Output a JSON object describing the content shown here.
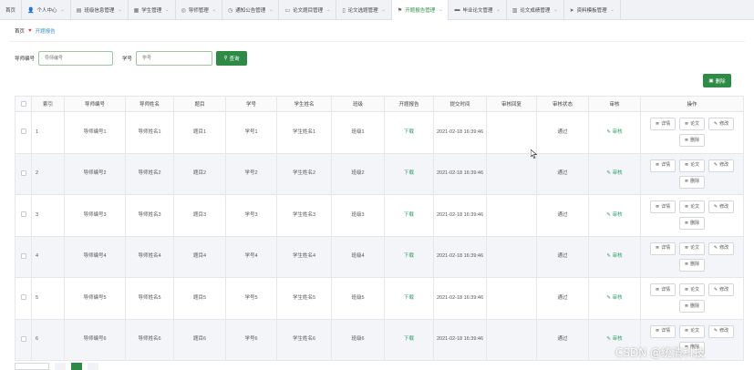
{
  "nav": [
    {
      "icon": "home-icon",
      "glyph": "",
      "label": "首页",
      "caret": false
    },
    {
      "icon": "user-icon",
      "glyph": "👤",
      "label": "个人中心",
      "caret": true
    },
    {
      "icon": "class-icon",
      "glyph": "▤",
      "label": "班级信息管理",
      "caret": true
    },
    {
      "icon": "student-icon",
      "glyph": "▦",
      "label": "学生管理",
      "caret": true
    },
    {
      "icon": "teacher-icon",
      "glyph": "◎",
      "label": "导师管理",
      "caret": true
    },
    {
      "icon": "notice-icon",
      "glyph": "◷",
      "label": "通知公告管理",
      "caret": true
    },
    {
      "icon": "topic-icon",
      "glyph": "▭",
      "label": "论文题目管理",
      "caret": true
    },
    {
      "icon": "select-icon",
      "glyph": "▯",
      "label": "论文选题管理",
      "caret": true
    },
    {
      "icon": "report-icon",
      "glyph": "⚑",
      "label": "开题报告管理",
      "caret": true
    },
    {
      "icon": "paper-icon",
      "glyph": "▬",
      "label": "毕业论文管理",
      "caret": true
    },
    {
      "icon": "grade-icon",
      "glyph": "▥",
      "label": "论文成绩管理",
      "caret": true
    },
    {
      "icon": "material-icon",
      "glyph": "➤",
      "label": "资料模板管理",
      "caret": true
    }
  ],
  "breadcrumb": {
    "home": "首页",
    "current": "开题报告"
  },
  "search": {
    "teacher_label": "导师编号",
    "teacher_placeholder": "导师编号",
    "student_label": "学号",
    "student_placeholder": "学号",
    "query_label": "查询"
  },
  "delete_label": "删除",
  "table": {
    "headers": [
      "索引",
      "导师编号",
      "导师姓名",
      "题目",
      "学号",
      "学生姓名",
      "班级",
      "开题报告",
      "提交时间",
      "审核回复",
      "审核状态",
      "审核",
      "操作"
    ],
    "rows": [
      {
        "idx": "1",
        "tno": "导师编号1",
        "tname": "导师姓名1",
        "title": "题目1",
        "sno": "学号1",
        "sname": "学生姓名1",
        "cls": "班级1",
        "report": "下载",
        "time": "2021-02-18 16:39:46",
        "reply": "",
        "status": "通过",
        "audit": "审核"
      },
      {
        "idx": "2",
        "tno": "导师编号2",
        "tname": "导师姓名2",
        "title": "题目2",
        "sno": "学号2",
        "sname": "学生姓名2",
        "cls": "班级2",
        "report": "下载",
        "time": "2021-02-18 16:39:46",
        "reply": "",
        "status": "通过",
        "audit": "审核"
      },
      {
        "idx": "3",
        "tno": "导师编号3",
        "tname": "导师姓名3",
        "title": "题目3",
        "sno": "学号3",
        "sname": "学生姓名3",
        "cls": "班级3",
        "report": "下载",
        "time": "2021-02-18 16:39:46",
        "reply": "",
        "status": "通过",
        "audit": "审核"
      },
      {
        "idx": "4",
        "tno": "导师编号4",
        "tname": "导师姓名4",
        "title": "题目4",
        "sno": "学号4",
        "sname": "学生姓名4",
        "cls": "班级4",
        "report": "下载",
        "time": "2021-02-18 16:39:46",
        "reply": "",
        "status": "通过",
        "audit": "审核"
      },
      {
        "idx": "5",
        "tno": "导师编号5",
        "tname": "导师姓名5",
        "title": "题目5",
        "sno": "学号5",
        "sname": "学生姓名5",
        "cls": "班级5",
        "report": "下载",
        "time": "2021-02-18 16:39:46",
        "reply": "",
        "status": "通过",
        "audit": "审核"
      },
      {
        "idx": "6",
        "tno": "导师编号6",
        "tname": "导师姓名6",
        "title": "题目6",
        "sno": "学号6",
        "sname": "学生姓名6",
        "cls": "班级6",
        "report": "下载",
        "time": "2021-02-18 16:39:46",
        "reply": "",
        "status": "通过",
        "audit": "审核"
      }
    ],
    "ops": {
      "detail": "详情",
      "paper": "论文",
      "edit": "修改",
      "delete": "删除"
    }
  },
  "watermark": "CSDN @统清科技",
  "colors": {
    "accent": "#2e8b46",
    "link": "#2e9e6a",
    "nav_bg": "#f0f2f5",
    "alt_row": "#f4f5f8"
  }
}
